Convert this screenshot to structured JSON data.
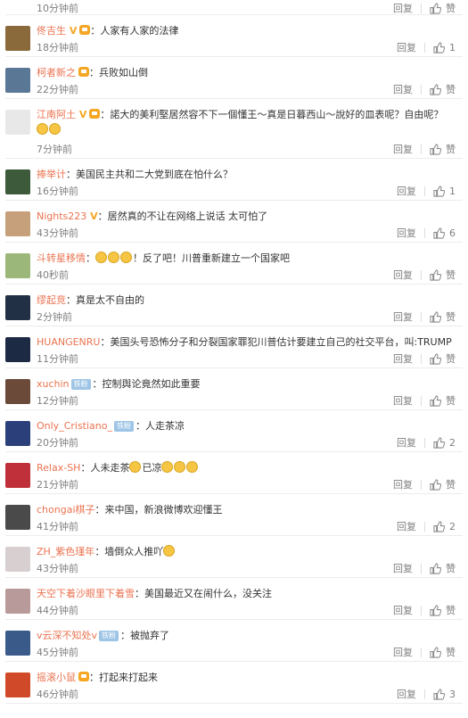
{
  "ui": {
    "reply_label": "回复",
    "like_label": "赞",
    "weibo_badge": "铁粉"
  },
  "first_row_cut": {
    "time": "10分钟前",
    "likes": "赞"
  },
  "comments": [
    {
      "name": "佟吉生",
      "v": true,
      "crown": true,
      "text": "：人家有人家的法律",
      "time": "18分钟前",
      "likes": "1",
      "avatar_color": "#8a6a3a"
    },
    {
      "name": "柯者新之",
      "crown": true,
      "text": "：兵败如山倒",
      "time": "22分钟前",
      "likes": "赞",
      "avatar_color": "#5a7896"
    },
    {
      "name": "江南阿土",
      "v": true,
      "crown": true,
      "text": "：諾大的美利堅居然容不下一個懂王～真是日暮西山～說好的皿表呢？自由呢？",
      "emojis": 2,
      "time": "7分钟前",
      "likes": "赞",
      "avatar_color": "#e8e8e8",
      "tall": true
    },
    {
      "name": "捧举计",
      "text": "：美国民主共和二大党到底在怕什么？",
      "time": "16分钟前",
      "likes": "1",
      "avatar_color": "#3d5a3a"
    },
    {
      "name": "Nights223",
      "v": true,
      "text": "：居然真的不让在网络上说话 太可怕了",
      "time": "43分钟前",
      "likes": "6",
      "avatar_color": "#c6a07a"
    },
    {
      "name": "斗转星移情",
      "pre_emojis": 3,
      "text": "！反了吧！川普重新建立一个国家吧",
      "time": "40秒前",
      "likes": "赞",
      "avatar_color": "#9bb87a"
    },
    {
      "name": "缪起竞",
      "text": "：真是太不自由的",
      "time": "2分钟前",
      "likes": "赞",
      "avatar_color": "#223046"
    },
    {
      "name": "HUANGENRU",
      "text": "：美国头号恐怖分子和分裂国家罪犯川普估计要建立自己的社交平台，叫:TRUMP",
      "time": "11分钟前",
      "likes": "赞",
      "avatar_color": "#1d2a44"
    },
    {
      "name": "xuchin",
      "badge": true,
      "text": "：控制舆论竟然如此重要",
      "time": "12分钟前",
      "likes": "赞",
      "avatar_color": "#6b4a3a"
    },
    {
      "name": "Only_Cristiano_",
      "badge": true,
      "text": "：人走茶凉",
      "time": "20分钟前",
      "likes": "2",
      "avatar_color": "#2b3f7a"
    },
    {
      "name": "Relax-SH",
      "text": "：人未走茶",
      "mid_text": "已凉",
      "emojis": 3,
      "time": "21分钟前",
      "likes": "赞",
      "avatar_color": "#c0303a"
    },
    {
      "name": "chongai棋子",
      "text": "：来中国，新浪微博欢迎懂王",
      "time": "41分钟前",
      "likes": "2",
      "avatar_color": "#4a4a4a"
    },
    {
      "name": "ZH_紫色瑾年",
      "text": "：墙倒众人推吖",
      "emojis": 1,
      "time": "43分钟前",
      "likes": "赞",
      "avatar_color": "#d8d0d0"
    },
    {
      "name": "天空下着沙眼里下着雪",
      "text": "：美国最近又在闹什么，没关注",
      "time": "44分钟前",
      "likes": "赞",
      "avatar_color": "#b89a9a"
    },
    {
      "name": "v云深不知处v",
      "badge": true,
      "text": "：被抛弃了",
      "time": "45分钟前",
      "likes": "赞",
      "avatar_color": "#3a5a8a"
    },
    {
      "name": "摇滚小鼠",
      "crown": true,
      "text": "：打起来打起来",
      "time": "46分钟前",
      "likes": "3",
      "avatar_color": "#d04a2a"
    }
  ]
}
